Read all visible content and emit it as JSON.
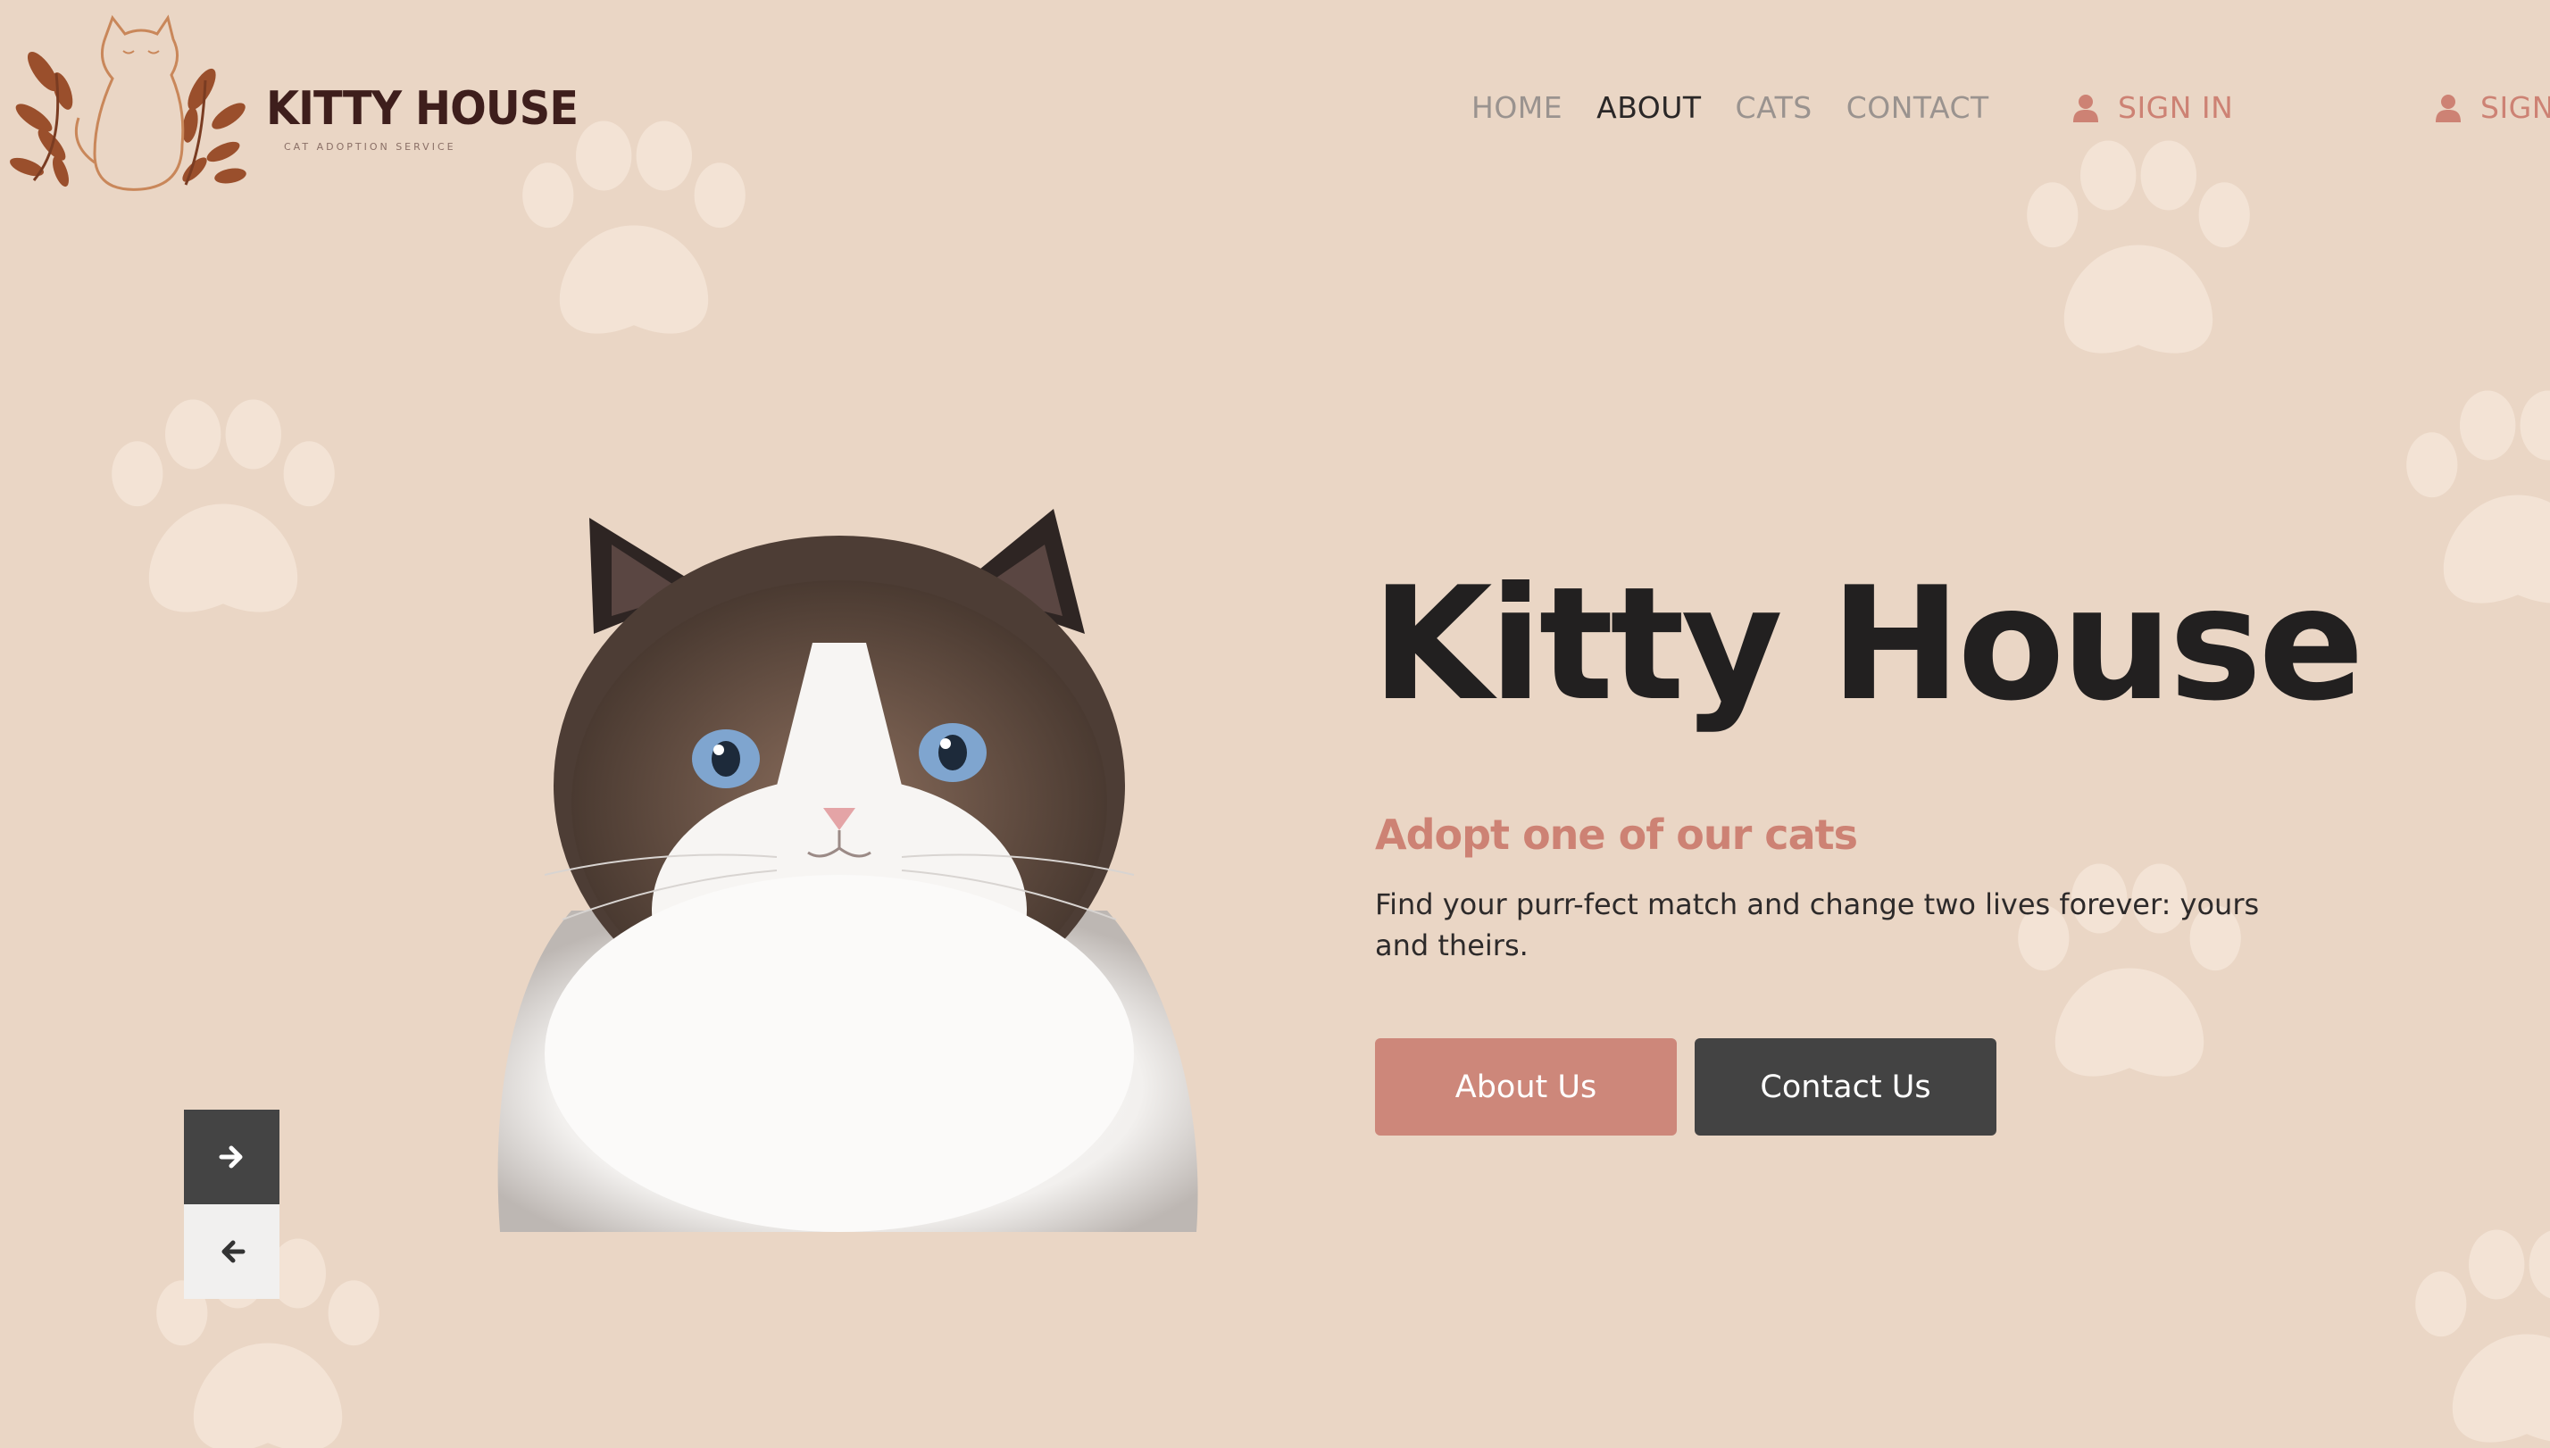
{
  "brand": {
    "name": "KITTY HOUSE",
    "tagline": "CAT ADOPTION SERVICE"
  },
  "nav": {
    "items": [
      {
        "label": "HOME",
        "active": false
      },
      {
        "label": "ABOUT",
        "active": true
      },
      {
        "label": "CATS",
        "active": false
      },
      {
        "label": "CONTACT",
        "active": false
      }
    ]
  },
  "auth": {
    "sign_in": "SIGN IN",
    "sign_up_clipped": "SIGN",
    "icon": "user-icon"
  },
  "hero": {
    "title": "Kitty House",
    "subtitle": "Adopt one of our cats",
    "description": "Find your purr-fect match and change two lives forever: yours and theirs.",
    "about_button": "About Us",
    "contact_button": "Contact Us"
  },
  "slider": {
    "next_icon": "arrow-right-icon",
    "prev_icon": "arrow-left-icon"
  },
  "colors": {
    "background": "#ead6c5",
    "accent": "#cd8274",
    "dark": "#222020",
    "button_dark": "#434343",
    "paw": "#f4e6d9"
  }
}
